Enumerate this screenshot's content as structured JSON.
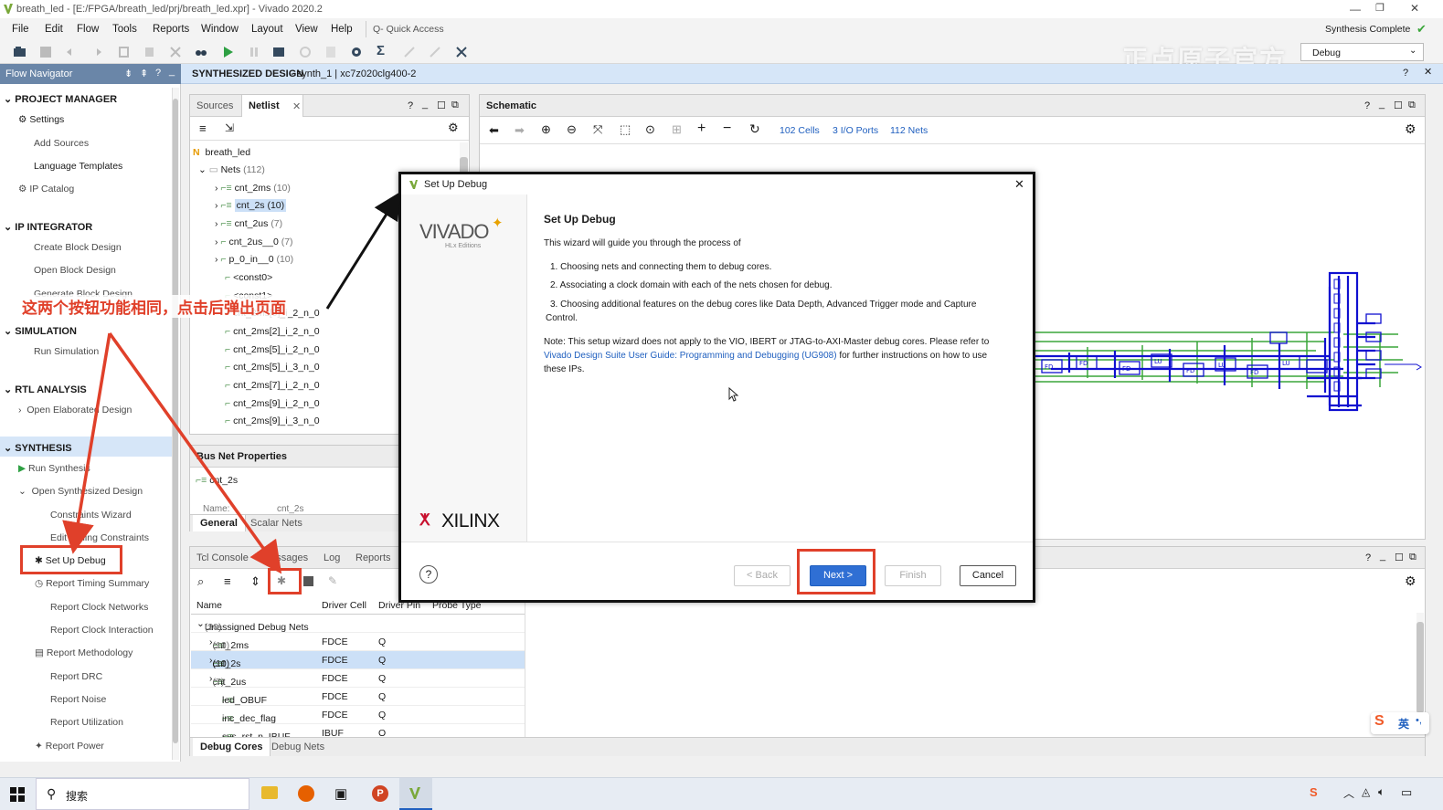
{
  "window": {
    "title": "breath_led - [E:/FPGA/breath_led/prj/breath_led.xpr] - Vivado 2020.2",
    "status": "Synthesis Complete"
  },
  "menu": [
    "File",
    "Edit",
    "Flow",
    "Tools",
    "Reports",
    "Window",
    "Layout",
    "View",
    "Help"
  ],
  "quick_access_placeholder": "Q- Quick Access",
  "layout_select": "Debug",
  "watermark": "正点原子官方",
  "flow_navigator": {
    "title": "Flow Navigator",
    "project_manager": {
      "title": "PROJECT MANAGER",
      "items": [
        "Settings",
        "Add Sources",
        "Language Templates",
        "IP Catalog"
      ]
    },
    "ip_integrator": {
      "title": "IP INTEGRATOR",
      "items": [
        "Create Block Design",
        "Open Block Design",
        "Generate Block Design"
      ]
    },
    "simulation": {
      "title": "SIMULATION",
      "items": [
        "Run Simulation"
      ]
    },
    "rtl_analysis": {
      "title": "RTL ANALYSIS",
      "items": [
        "Open Elaborated Design"
      ]
    },
    "synthesis": {
      "title": "SYNTHESIS",
      "items": [
        "Run Synthesis",
        "Open Synthesized Design",
        "Constraints Wizard",
        "Edit Timing Constraints",
        "Set Up Debug",
        "Report Timing Summary",
        "Report Clock Networks",
        "Report Clock Interaction",
        "Report Methodology",
        "Report DRC",
        "Report Noise",
        "Report Utilization",
        "Report Power"
      ]
    }
  },
  "synth_header": {
    "title": "SYNTHESIZED DESIGN",
    "subtitle": " - synth_1 | xc7z020clg400-2"
  },
  "netlist": {
    "tabs": [
      "Sources",
      "Netlist"
    ],
    "top": "breath_led",
    "nets_label": "Nets",
    "nets_count": "(112)",
    "rows": [
      {
        "name": "cnt_2ms",
        "count": "(10)"
      },
      {
        "name": "cnt_2s",
        "count": "(10)"
      },
      {
        "name": "cnt_2us",
        "count": "(7)"
      },
      {
        "name": "cnt_2us__0",
        "count": "(7)"
      },
      {
        "name": "p_0_in__0",
        "count": "(10)"
      }
    ],
    "leaf": [
      "<const0>",
      "<const1>",
      "cnt_2ms[0]_i_2_n_0",
      "cnt_2ms[2]_i_2_n_0",
      "cnt_2ms[5]_i_2_n_0",
      "cnt_2ms[5]_i_3_n_0",
      "cnt_2ms[7]_i_2_n_0",
      "cnt_2ms[9]_i_2_n_0",
      "cnt_2ms[9]_i_3_n_0"
    ]
  },
  "bus_props": {
    "title": "Bus Net Properties",
    "net": "cnt_2s",
    "name_label": "Name:",
    "name_val": "cnt_2s",
    "tabs": [
      "General",
      "Scalar Nets"
    ]
  },
  "schematic": {
    "title": "Schematic",
    "cells": "102 Cells",
    "ports": "3 I/O Ports",
    "nets": "112 Nets"
  },
  "console": {
    "tabs": [
      "Tcl Console",
      "Messages",
      "Log",
      "Reports"
    ],
    "columns": [
      "Name",
      "Driver Cell",
      "Driver Pin",
      "Probe Type"
    ],
    "group": "Unassigned Debug Nets",
    "group_count": "(30)",
    "rows": [
      {
        "name": "cnt_2ms",
        "count": "(10)",
        "cell": "FDCE",
        "pin": "Q"
      },
      {
        "name": "cnt_2s",
        "count": "(10)",
        "cell": "FDCE",
        "pin": "Q"
      },
      {
        "name": "cnt_2us",
        "count": "(7)",
        "cell": "FDCE",
        "pin": "Q"
      },
      {
        "name": "led_OBUF",
        "count": "",
        "cell": "FDCE",
        "pin": "Q"
      },
      {
        "name": "inc_dec_flag",
        "count": "",
        "cell": "FDCE",
        "pin": "Q"
      },
      {
        "name": "sys_rst_n_IBUF",
        "count": "",
        "cell": "IBUF",
        "pin": "O"
      }
    ],
    "bottom_tabs": [
      "Debug Cores",
      "Debug Nets"
    ]
  },
  "dialog": {
    "title": "Set Up Debug",
    "heading": "Set Up Debug",
    "intro": "This wizard will guide you through the process of",
    "steps": [
      "1.  Choosing nets and connecting them to debug cores.",
      "2.  Associating a clock domain with each of the nets chosen for debug.",
      "3.  Choosing additional features on the debug cores like Data Depth, Advanced Trigger mode and Capture Control."
    ],
    "note_prefix": "Note: This setup wizard does not apply to the VIO, IBERT or JTAG-to-AXI-Master debug cores. Please refer to ",
    "note_link": "Vivado Design Suite User Guide: Programming and Debugging (UG908)",
    "note_suffix": " for further instructions on how to use these IPs.",
    "vivado": "VIVADO",
    "vivado_sub": "HLx Editions",
    "xilinx": "XILINX",
    "buttons": {
      "back": "< Back",
      "next": "Next >",
      "finish": "Finish",
      "cancel": "Cancel"
    }
  },
  "annotation": "这两个按钮功能相同，点击后弹出页面",
  "taskbar": {
    "search": "搜索",
    "ime": "英"
  },
  "colors": {
    "accent": "#1f5fbf",
    "annotation": "#e0402a",
    "schematic_blue": "#1010d0",
    "schematic_green": "#3aa63a"
  }
}
